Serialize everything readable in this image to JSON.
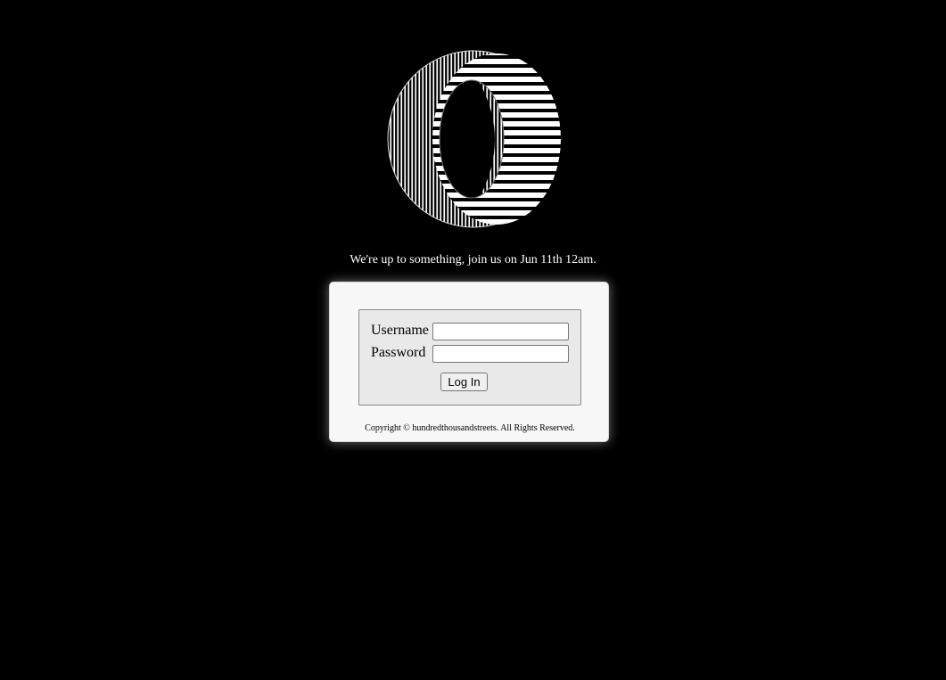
{
  "logo": {
    "icon": "striped-o-logo-icon",
    "colors": {
      "stripe": "#ffffff",
      "ground": "#000000"
    }
  },
  "tagline": "We're up to something, join us on Jun 11th 12am.",
  "login": {
    "username_label": "Username",
    "password_label": "Password",
    "username_value": "",
    "password_value": "",
    "submit_label": "Log In"
  },
  "footer": {
    "copyright": "Copyright © hundredthousandstreets. All Rights Reserved."
  }
}
